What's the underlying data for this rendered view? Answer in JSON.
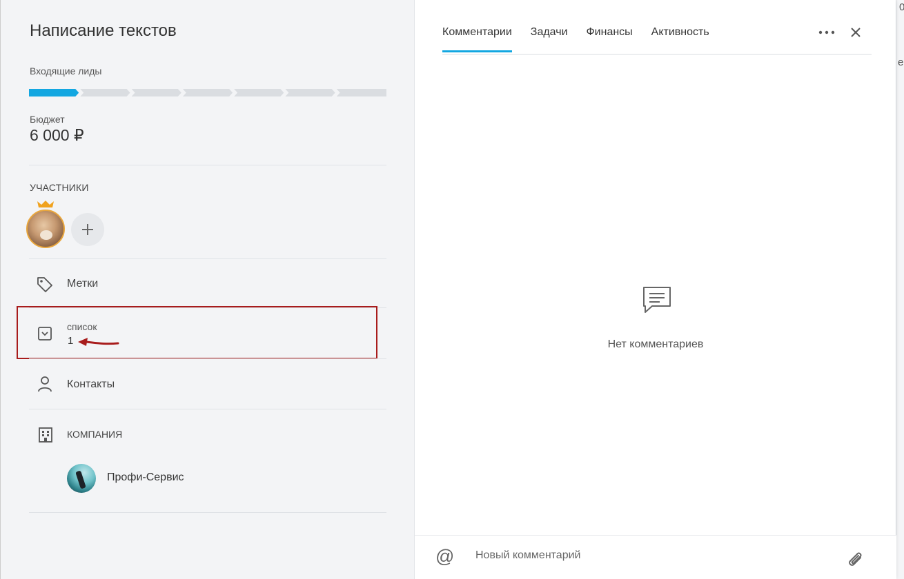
{
  "deal": {
    "title": "Написание текстов",
    "stage_label": "Входящие лиды",
    "pipeline_stages": 7,
    "active_stage_index": 0,
    "budget_label": "Бюджет",
    "budget_value": "6 000 ₽"
  },
  "participants": {
    "label": "УЧАСТНИКИ"
  },
  "fields": {
    "tags_label": "Метки",
    "list_label": "список",
    "list_value": "1",
    "contacts_label": "Контакты",
    "company_label": "КОМПАНИЯ",
    "company_name": "Профи-Сервис"
  },
  "tabs": [
    {
      "label": "Комментарии",
      "active": true
    },
    {
      "label": "Задачи",
      "active": false
    },
    {
      "label": "Финансы",
      "active": false
    },
    {
      "label": "Активность",
      "active": false
    }
  ],
  "comments": {
    "empty_text": "Нет комментариев",
    "input_placeholder": "Новый комментарий",
    "mention_symbol": "@"
  },
  "colors": {
    "accent": "#13a7e1",
    "highlight_border": "#a81c1c",
    "crown": "#f0a21e"
  }
}
